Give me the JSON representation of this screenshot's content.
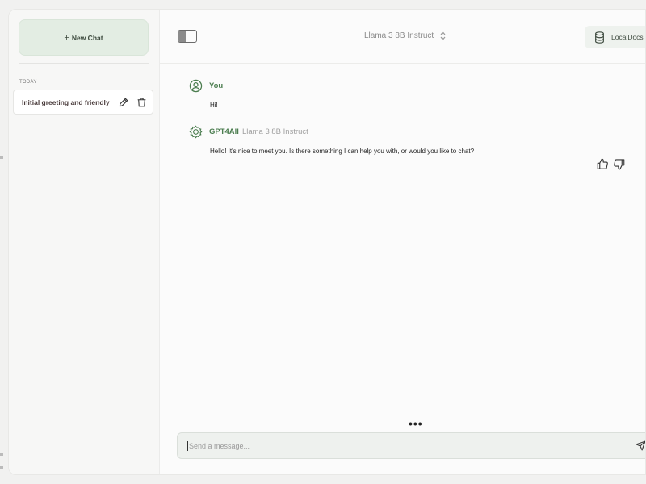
{
  "sidebar": {
    "new_chat_label": "New Chat",
    "new_chat_plus": "+",
    "section_today": "TODAY",
    "chats": [
      {
        "label": "Initial greeting and friendly"
      }
    ]
  },
  "header": {
    "model_name": "Llama 3 8B Instruct",
    "localdocs_label": "LocalDocs"
  },
  "messages": [
    {
      "author": "You",
      "text": "Hi!"
    },
    {
      "author": "GPT4All",
      "model": "Llama 3 8B Instruct",
      "text": "Hello! It's nice to meet you. Is there something I can help you with, or would you like to chat?"
    }
  ],
  "composer": {
    "placeholder": "Send a message...",
    "more_label": "•••"
  },
  "colors": {
    "accent_green": "#4b7d4f",
    "new_chat_bg": "#e3ede3",
    "input_bg": "#eef1ee"
  },
  "icons": {
    "edit": "pencil-icon",
    "delete": "trash-icon",
    "sidebar_toggle": "sidebar-toggle-icon",
    "localdocs": "database-icon",
    "user": "user-circle-icon",
    "assistant": "gear-icon",
    "like": "thumbs-up-icon",
    "dislike": "thumbs-down-icon",
    "send": "send-icon"
  }
}
